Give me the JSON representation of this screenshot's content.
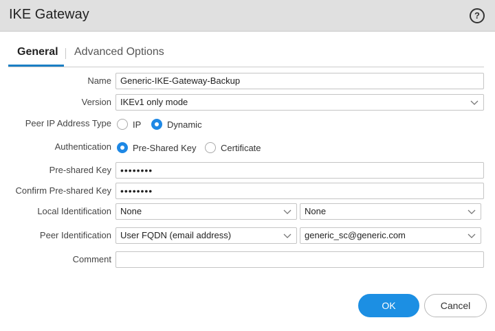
{
  "dialog": {
    "title": "IKE Gateway",
    "help_icon": "?"
  },
  "tabs": [
    {
      "label": "General",
      "active": true
    },
    {
      "label": "Advanced Options",
      "active": false
    }
  ],
  "form": {
    "name": {
      "label": "Name",
      "value": "Generic-IKE-Gateway-Backup"
    },
    "version": {
      "label": "Version",
      "value": "IKEv1 only mode"
    },
    "peer_ip_type": {
      "label": "Peer IP Address Type",
      "options": [
        "IP",
        "Dynamic"
      ],
      "selected": "Dynamic"
    },
    "authentication": {
      "label": "Authentication",
      "options": [
        "Pre-Shared Key",
        "Certificate"
      ],
      "selected": "Pre-Shared Key"
    },
    "pre_shared_key": {
      "label": "Pre-shared Key",
      "value": "••••••••"
    },
    "confirm_pre_shared_key": {
      "label": "Confirm Pre-shared Key",
      "value": "••••••••"
    },
    "local_identification": {
      "label": "Local Identification",
      "type_value": "None",
      "value": "None"
    },
    "peer_identification": {
      "label": "Peer Identification",
      "type_value": "User FQDN (email address)",
      "value": "generic_sc@generic.com"
    },
    "comment": {
      "label": "Comment",
      "value": ""
    }
  },
  "buttons": {
    "ok": "OK",
    "cancel": "Cancel"
  },
  "colors": {
    "accent": "#1c8fe3",
    "titlebar": "#e0e0e0"
  }
}
